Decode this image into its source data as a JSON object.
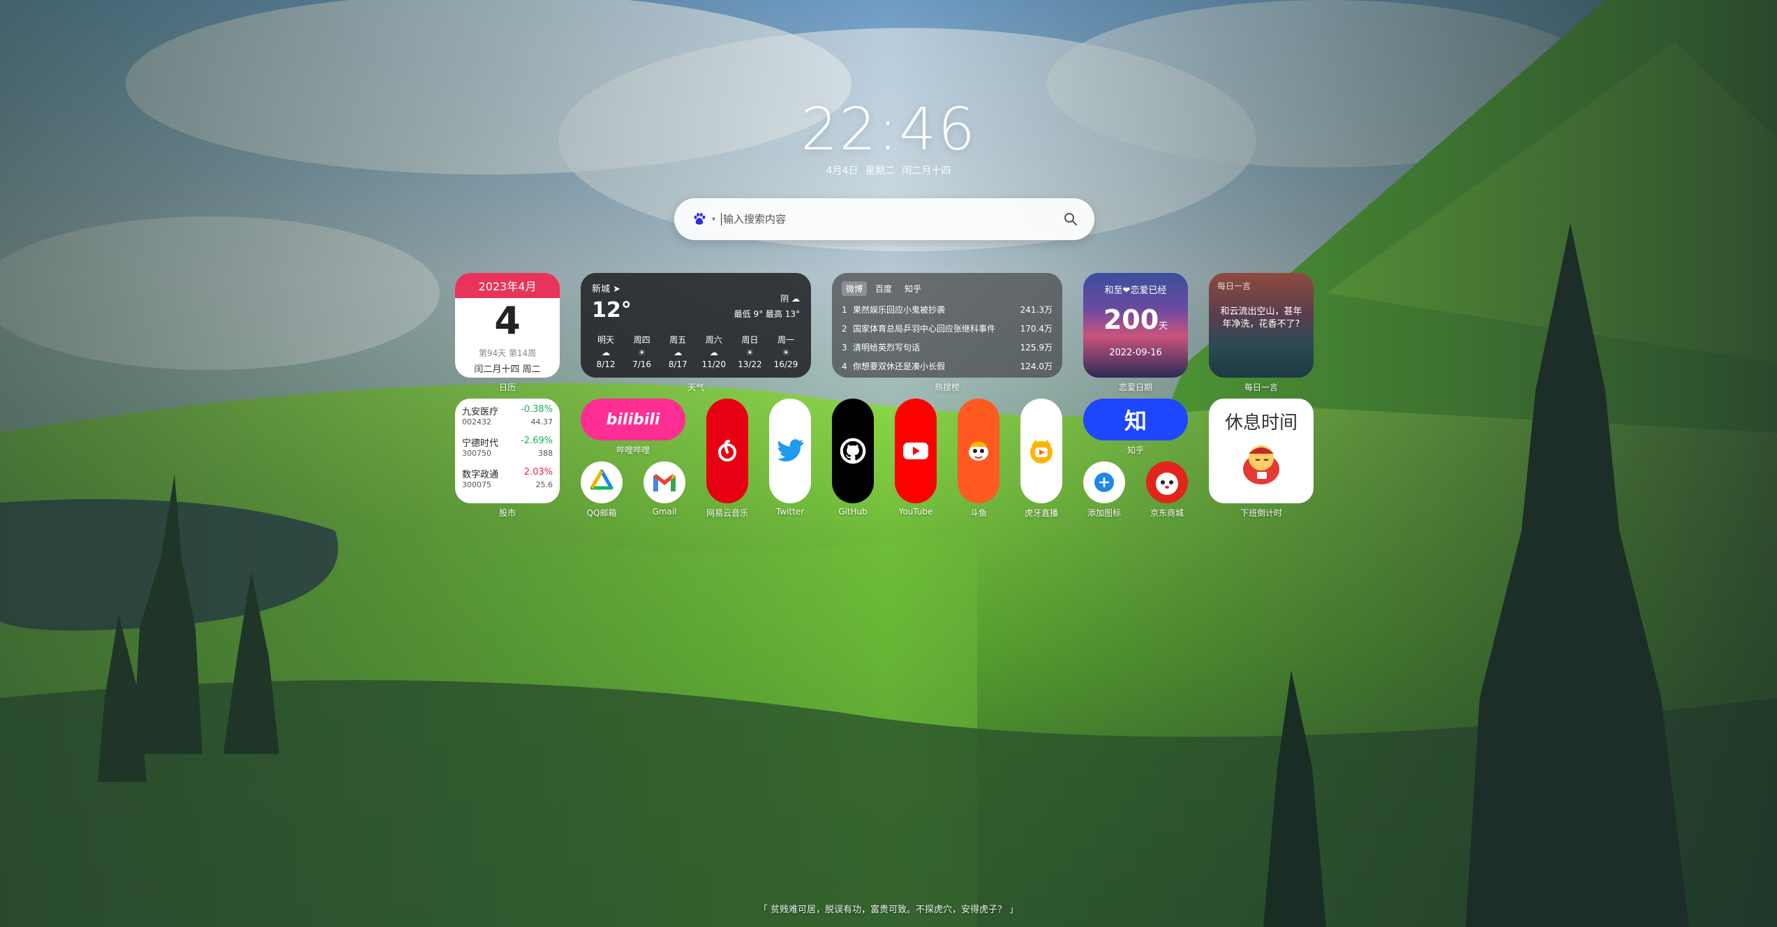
{
  "clock": {
    "time": "22:46",
    "date": "4月4日  星期二  闰二月十四"
  },
  "search": {
    "placeholder": "输入搜索内容",
    "engine_icon": "baidu-paw-icon"
  },
  "calendar": {
    "month": "2023年4月",
    "day": "4",
    "week": "第94天 第14周",
    "lunar": "闰二月十四 周二",
    "label": "日历"
  },
  "weather": {
    "city": "新城",
    "temp": "12°",
    "condition": "阴",
    "range": "最低 9° 最高 13°",
    "label": "天气",
    "days": [
      {
        "name": "明天",
        "date": "8/12",
        "icon": "cloud"
      },
      {
        "name": "周四",
        "date": "7/16",
        "icon": "sun"
      },
      {
        "name": "周五",
        "date": "8/17",
        "icon": "cloud"
      },
      {
        "name": "周六",
        "date": "11/20",
        "icon": "cloud"
      },
      {
        "name": "周日",
        "date": "13/22",
        "icon": "sun"
      },
      {
        "name": "周一",
        "date": "16/29",
        "icon": "sun"
      }
    ]
  },
  "hot": {
    "tabs": [
      "微博",
      "百度",
      "知乎"
    ],
    "label": "热搜榜",
    "items": [
      {
        "rank": "1",
        "title": "果然娱乐回应小鬼被抄袭",
        "count": "241.3万"
      },
      {
        "rank": "2",
        "title": "国家体育总局乒羽中心回应张继科事件",
        "count": "170.4万"
      },
      {
        "rank": "3",
        "title": "清明给英烈写句话",
        "count": "125.9万"
      },
      {
        "rank": "4",
        "title": "你想要双休还是凑小长假",
        "count": "124.0万"
      }
    ]
  },
  "love": {
    "title": "和至❤恋爱已经",
    "days": "200",
    "unit": "天",
    "date": "2022-09-16",
    "label": "恋爱日期"
  },
  "quote": {
    "title": "每日一言",
    "text": "和云流出空山，甚年年净洗，花香不了?",
    "label": "每日一言"
  },
  "stocks": {
    "label": "股市",
    "items": [
      {
        "name": "九安医疗",
        "change": "-0.38%",
        "code": "002432",
        "price": "44.37",
        "dir": "down"
      },
      {
        "name": "宁德时代",
        "change": "-2.69%",
        "code": "300750",
        "price": "388",
        "dir": "down"
      },
      {
        "name": "数字政通",
        "change": "2.03%",
        "code": "300075",
        "price": "25.6",
        "dir": "up"
      }
    ]
  },
  "apps": {
    "bilibili": {
      "label": "哔哩哔哩",
      "logo": "bilibili",
      "color": "#ff2e93"
    },
    "qqmail": {
      "label": "QQ邮箱"
    },
    "gmail": {
      "label": "Gmail"
    },
    "netease": {
      "label": "网易云音乐",
      "color": "#e60012"
    },
    "twitter": {
      "label": "Twitter",
      "color": "#1d9bf0"
    },
    "github": {
      "label": "GitHub"
    },
    "youtube": {
      "label": "YouTube",
      "color": "#ff0000"
    },
    "douyu": {
      "label": "斗鱼",
      "color": "#ff5a1f"
    },
    "huya": {
      "label": "虎牙直播",
      "color": "#ffb400"
    },
    "zhihu": {
      "label": "知乎",
      "glyph": "知",
      "color": "#1f47ff"
    },
    "add": {
      "label": "添加图标"
    },
    "jd": {
      "label": "京东商城",
      "color": "#e1251b"
    },
    "rest": {
      "label": "下班倒计时",
      "title": "休息时间"
    }
  },
  "bottom_quote": "「 贫贱难可居，脱误有功，富贵可致。不探虎穴，安得虎子？ 」"
}
